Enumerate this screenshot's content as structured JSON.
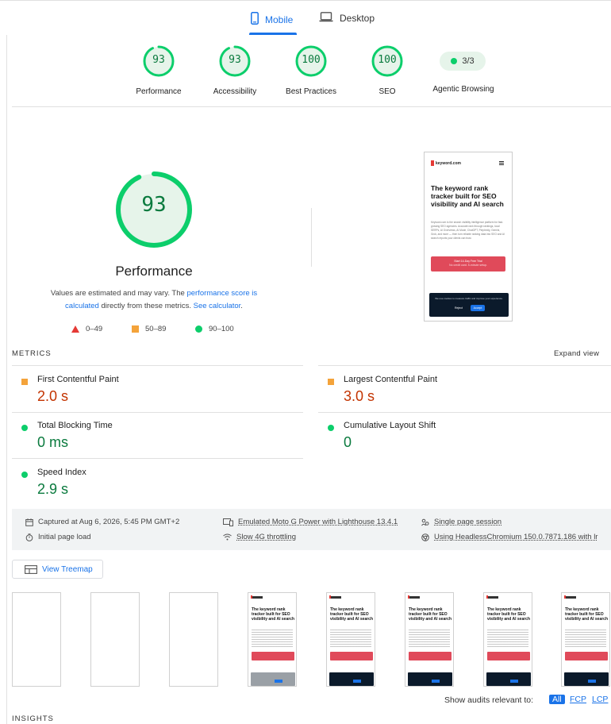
{
  "tabs": [
    {
      "label": "Mobile",
      "icon": "phone-icon",
      "active": true
    },
    {
      "label": "Desktop",
      "icon": "laptop-icon",
      "active": false
    }
  ],
  "categories": [
    {
      "score": "93",
      "label": "Performance",
      "value": 93
    },
    {
      "score": "93",
      "label": "Accessibility",
      "value": 93
    },
    {
      "score": "100",
      "label": "Best Practices",
      "value": 100
    },
    {
      "score": "100",
      "label": "SEO",
      "value": 100
    }
  ],
  "agentic": {
    "value": "3/3",
    "label": "Agentic Browsing"
  },
  "performance": {
    "score": "93",
    "value": 93,
    "title": "Performance",
    "note_pre": "Values are estimated and may vary. The ",
    "note_link1": "performance score is calculated",
    "note_mid": " directly from these metrics. ",
    "note_link2": "See calculator",
    "note_post": "."
  },
  "legend": [
    {
      "shape": "triangle",
      "range": "0–49",
      "color": "#e53935"
    },
    {
      "shape": "square",
      "range": "50–89",
      "color": "#f4a33a"
    },
    {
      "shape": "circle",
      "range": "90–100",
      "color": "#0cce6b"
    }
  ],
  "screenshot": {
    "logo": "keyword.com",
    "headline": "The keyword rank tracker built for SEO visibility and AI search",
    "body": "Keyword.com is the search visibility intelligence platform for fast-growing SEO agencies. Accurate rank through rankings, local SERPs, AI Overviews, AI Mode, ChatGPT, Perplexity, Gemini, Grok, and more — then turn reliable ranking data into SEO and AI search reports your clients can trust.",
    "cta": "Start 14-Day Free Trial",
    "cta_sub": "No credit card. 5-minute setup.",
    "cookie_text": "We use cookies to measure traffic and improve your experience.",
    "cookie_reject": "Reject",
    "cookie_accept": "Accept"
  },
  "metrics": {
    "title": "METRICS",
    "expand": "Expand view",
    "items": [
      {
        "label": "First Contentful Paint",
        "value": "2.0 s",
        "rating": "average"
      },
      {
        "label": "Largest Contentful Paint",
        "value": "3.0 s",
        "rating": "average"
      },
      {
        "label": "Total Blocking Time",
        "value": "0 ms",
        "rating": "pass"
      },
      {
        "label": "Cumulative Layout Shift",
        "value": "0",
        "rating": "pass"
      },
      {
        "label": "Speed Index",
        "value": "2.9 s",
        "rating": "pass"
      }
    ]
  },
  "run_info": {
    "captured": "Captured at Aug 6, 2026, 5:45 PM GMT+2",
    "load": "Initial page load",
    "device": "Emulated Moto G Power with Lighthouse 13.4.1",
    "throttling": "Slow 4G throttling",
    "session": "Single page session",
    "browser": "Using HeadlessChromium 150.0.7871.186 with lr"
  },
  "treemap_label": "View Treemap",
  "filmstrip_headline": "The keyword rank tracker built for SEO visibility and AI search",
  "audits_filter": {
    "label": "Show audits relevant to:",
    "options": [
      "All",
      "FCP",
      "LCP"
    ]
  },
  "insights_title": "INSIGHTS",
  "colors": {
    "pass": "#0cce6b",
    "pass_text": "#0a7a3e",
    "average": "#f4a33a",
    "average_text": "#c33300",
    "fail": "#e53935",
    "link": "#1a73e8"
  }
}
